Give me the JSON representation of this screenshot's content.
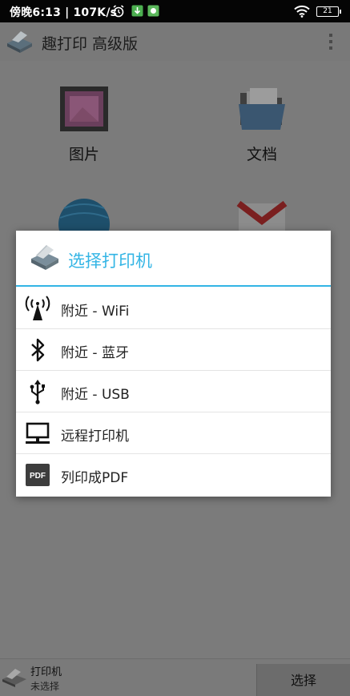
{
  "status_bar": {
    "time_speed": "傍晚6:13 | 107K/s",
    "battery": "21"
  },
  "app_bar": {
    "title": "趣打印 高级版"
  },
  "grid": {
    "items": [
      {
        "label": "图片"
      },
      {
        "label": "文档"
      }
    ]
  },
  "dialog": {
    "title": "选择打印机",
    "options": [
      {
        "label": "附近 - WiFi",
        "icon": "wifi-antenna-icon"
      },
      {
        "label": "附近 - 蓝牙",
        "icon": "bluetooth-icon"
      },
      {
        "label": "附近 - USB",
        "icon": "usb-icon"
      },
      {
        "label": "远程打印机",
        "icon": "computer-icon"
      },
      {
        "label": "列印成PDF",
        "icon": "pdf-icon"
      }
    ]
  },
  "bottom_bar": {
    "printer_title": "打印机",
    "printer_status": "未选择",
    "select_label": "选择"
  },
  "colors": {
    "accent": "#33b5e5",
    "scrim_background": "#7b7b7b"
  }
}
